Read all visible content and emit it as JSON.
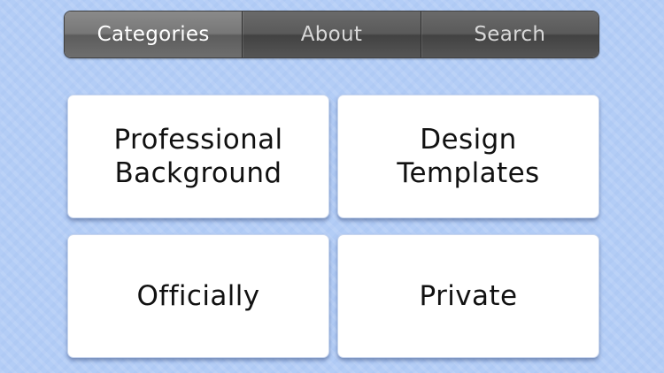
{
  "tabs": [
    {
      "label": "Categories",
      "selected": true
    },
    {
      "label": "About",
      "selected": false
    },
    {
      "label": "Search",
      "selected": false
    }
  ],
  "categories": [
    {
      "label": "Professional\nBackground"
    },
    {
      "label": "Design\nTemplates"
    },
    {
      "label": "Officially"
    },
    {
      "label": "Private"
    }
  ],
  "colors": {
    "background": "#b3cdf6",
    "segmented_bar": "#555555",
    "tile": "#ffffff",
    "tile_text": "#111111"
  }
}
